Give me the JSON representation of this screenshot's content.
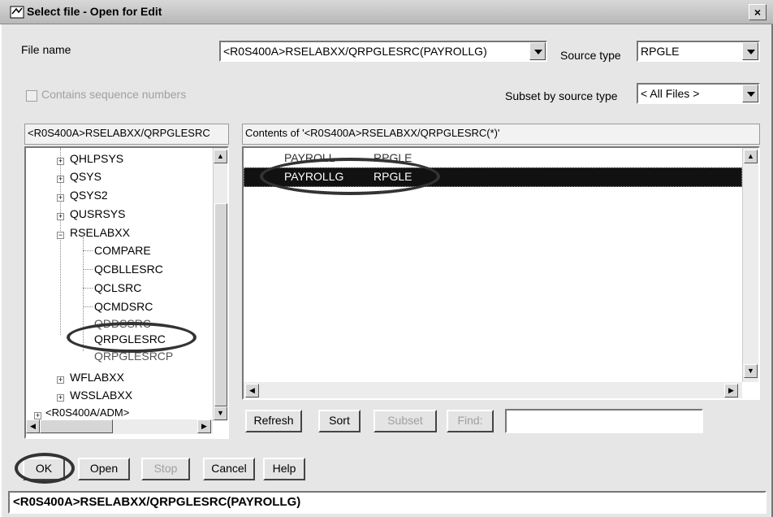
{
  "window": {
    "title": "Select file - Open for Edit",
    "close_label": "×"
  },
  "file_name": {
    "label": "File name",
    "value": "<R0S400A>RSELABXX/QRPGLESRC(PAYROLLG)"
  },
  "source_type": {
    "label": "Source type",
    "value": "RPGLE"
  },
  "sequence": {
    "label": "Contains sequence numbers",
    "checked": false
  },
  "subset": {
    "label": "Subset by source type",
    "value": "< All Files >"
  },
  "tree": {
    "header": "<R0S400A>RSELABXX/QRPGLESRC",
    "items": [
      {
        "label": "QHLPSYS"
      },
      {
        "label": "QSYS"
      },
      {
        "label": "QSYS2"
      },
      {
        "label": "QUSRSYS"
      },
      {
        "label": "RSELABXX"
      },
      {
        "label": "COMPARE"
      },
      {
        "label": "QCBLLESRC"
      },
      {
        "label": "QCLSRC"
      },
      {
        "label": "QCMDSRC"
      },
      {
        "label": "QDDSSRC"
      },
      {
        "label": "QRPGLESRC"
      },
      {
        "label": "QRPGLESRCP"
      },
      {
        "label": "WFLABXX"
      },
      {
        "label": "WSSLABXX"
      },
      {
        "label": "<R0S400A/ADM>"
      }
    ]
  },
  "contents": {
    "header": "Contents of '<R0S400A>RSELABXX/QRPGLESRC(*)'",
    "rows": [
      {
        "name": "PAYROLL",
        "type": "RPGLE",
        "selected": false
      },
      {
        "name": "PAYROLLG",
        "type": "RPGLE",
        "selected": true
      }
    ]
  },
  "actions": {
    "refresh": "Refresh",
    "sort": "Sort",
    "subset": "Subset",
    "find": "Find:",
    "find_value": ""
  },
  "buttons": {
    "ok": "OK",
    "open": "Open",
    "stop": "Stop",
    "cancel": "Cancel",
    "help": "Help"
  },
  "status": "<R0S400A>RSELABXX/QRPGLESRC(PAYROLLG)",
  "colors": {
    "selection": "#111111",
    "annotation": "#333333"
  }
}
